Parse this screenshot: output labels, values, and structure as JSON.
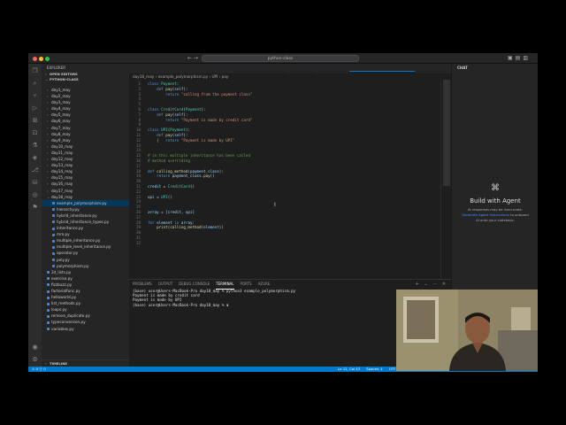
{
  "window": {
    "search": "python-class"
  },
  "activity_icons": [
    "files-icon",
    "search-icon",
    "source-control-icon",
    "run-debug-icon",
    "extensions-icon",
    "remote-icon",
    "testing-icon",
    "docker-icon",
    "git-graph-icon",
    "database-icon",
    "browser-icon",
    "flask-icon"
  ],
  "sidebar": {
    "title": "EXPLORER",
    "open_editors": "OPEN EDITORS",
    "root": "PYTHON-CLASS",
    "outline": "TIMELINE",
    "items": [
      {
        "label": "day1_may",
        "kind": "folder"
      },
      {
        "label": "day2_may",
        "kind": "folder"
      },
      {
        "label": "day3_may",
        "kind": "folder"
      },
      {
        "label": "day4_may",
        "kind": "folder"
      },
      {
        "label": "day5_may",
        "kind": "folder"
      },
      {
        "label": "day6_may",
        "kind": "folder"
      },
      {
        "label": "day7_may",
        "kind": "folder"
      },
      {
        "label": "day8_may",
        "kind": "folder"
      },
      {
        "label": "day9_may",
        "kind": "folder"
      },
      {
        "label": "day10_may",
        "kind": "folder"
      },
      {
        "label": "day11_may",
        "kind": "folder"
      },
      {
        "label": "day12_may",
        "kind": "folder"
      },
      {
        "label": "day13_may",
        "kind": "folder"
      },
      {
        "label": "day14_may",
        "kind": "folder"
      },
      {
        "label": "day15_may",
        "kind": "folder"
      },
      {
        "label": "day16_may",
        "kind": "folder"
      },
      {
        "label": "day17_may",
        "kind": "folder"
      },
      {
        "label": "day18_may",
        "kind": "folder"
      },
      {
        "label": "example_polymorphism.py",
        "kind": "file",
        "selected": true
      },
      {
        "label": "hierarchy.py",
        "kind": "file"
      },
      {
        "label": "hybrid_inheritance.py",
        "kind": "file"
      },
      {
        "label": "hybrid_inheritance_types.py",
        "kind": "file"
      },
      {
        "label": "inheritance.py",
        "kind": "file"
      },
      {
        "label": "mro.py",
        "kind": "file"
      },
      {
        "label": "multiple_inheritance.py",
        "kind": "file"
      },
      {
        "label": "multiple_level_inheritance.py",
        "kind": "file"
      },
      {
        "label": "operator.py",
        "kind": "file"
      },
      {
        "label": "poly.py",
        "kind": "file"
      },
      {
        "label": "polymorphism.py",
        "kind": "file"
      },
      {
        "label": "2d_lists.py",
        "kind": "rootfile"
      },
      {
        "label": "exercise.py",
        "kind": "rootfile"
      },
      {
        "label": "fizzbuzz.py",
        "kind": "rootfile"
      },
      {
        "label": "factorialfunc.py",
        "kind": "rootfile"
      },
      {
        "label": "helloworld.py",
        "kind": "rootfile"
      },
      {
        "label": "list_methods.py",
        "kind": "rootfile"
      },
      {
        "label": "loops.py",
        "kind": "rootfile"
      },
      {
        "label": "remove_duplicate.py",
        "kind": "rootfile"
      },
      {
        "label": "typeconversion.py",
        "kind": "rootfile"
      },
      {
        "label": "variables.py",
        "kind": "rootfile"
      }
    ]
  },
  "tabs": [
    {
      "label": "hybrid_inheritance.py",
      "active": false
    },
    {
      "label": "mro.py",
      "active": false
    },
    {
      "label": "polymorphism.py day18_may",
      "active": false
    },
    {
      "label": "poly.py",
      "active": false
    },
    {
      "label": "operator.py",
      "active": false
    },
    {
      "label": "example_polymorphism.py",
      "active": true
    }
  ],
  "breadcrumb": "day18_may  ›  example_polymorphism.py  ›  UPI  ›  pay",
  "code": [
    {
      "n": "1",
      "html": "<span class='kw'>class</span> <span class='cls'>Payment</span>:"
    },
    {
      "n": "2",
      "html": "    <span class='kw'>def</span> <span class='fn'>pay</span>(<span class='var'>self</span>):"
    },
    {
      "n": "3",
      "html": "        <span class='kw'>return</span> <span class='str'>\"calling from the payment class\"</span>"
    },
    {
      "n": "4",
      "html": ""
    },
    {
      "n": "5",
      "html": ""
    },
    {
      "n": "6",
      "html": "<span class='kw'>class</span> <span class='cls'>CreditCard</span>(<span class='cls'>Payment</span>):"
    },
    {
      "n": "7",
      "html": "    <span class='kw'>def</span> <span class='fn'>pay</span>(<span class='var'>self</span>):"
    },
    {
      "n": "8",
      "html": "        <span class='kw'>return</span> <span class='str'>\"Payment is made by credit card\"</span>"
    },
    {
      "n": "9",
      "html": ""
    },
    {
      "n": "10",
      "html": "<span class='kw'>class</span> <span class='cls'>UPI</span>(<span class='cls'>Payment</span>):"
    },
    {
      "n": "11",
      "html": "    <span class='kw'>def</span> <span class='fn'>pay</span>(<span class='var'>self</span>):"
    },
    {
      "n": "12",
      "html": "    |   <span class='kw'>return</span> <span class='str'>\"Payment is made by UPI\"</span>"
    },
    {
      "n": "13",
      "html": ""
    },
    {
      "n": "14",
      "html": ""
    },
    {
      "n": "15",
      "html": "<span class='cmt'># in this multiple inheritance has been called</span>"
    },
    {
      "n": "16",
      "html": "<span class='cmt'># method overriding</span>"
    },
    {
      "n": "17",
      "html": ""
    },
    {
      "n": "18",
      "html": "<span class='kw'>def</span> <span class='fn'>calling_method</span>(<span class='var'>payment_class</span>):"
    },
    {
      "n": "19",
      "html": "    <span class='kw'>return</span> <span class='var'>payment_class</span>.<span class='fn'>pay</span>()"
    },
    {
      "n": "20",
      "html": ""
    },
    {
      "n": "21",
      "html": "<span class='var'>credit</span> = <span class='cls'>CreditCard</span>()"
    },
    {
      "n": "22",
      "html": ""
    },
    {
      "n": "23",
      "html": "<span class='var'>upi</span> = <span class='cls'>UPI</span>()"
    },
    {
      "n": "24",
      "html": ""
    },
    {
      "n": "25",
      "html": ""
    },
    {
      "n": "26",
      "html": "<span class='var'>array</span> = [<span class='var'>credit</span>, <span class='var'>upi</span>]"
    },
    {
      "n": "27",
      "html": ""
    },
    {
      "n": "28",
      "html": "<span class='kw'>for</span> <span class='var'>element</span> <span class='kw'>in</span> <span class='var'>array</span>:"
    },
    {
      "n": "29",
      "html": "    <span class='fn'>print</span>(<span class='fn'>calling_method</span>(<span class='var'>element</span>))"
    },
    {
      "n": "30",
      "html": ""
    },
    {
      "n": "31",
      "html": ""
    },
    {
      "n": "32",
      "html": ""
    }
  ],
  "panel": {
    "tabs": [
      {
        "label": "PROBLEMS",
        "active": false
      },
      {
        "label": "OUTPUT",
        "active": false
      },
      {
        "label": "DEBUG CONSOLE",
        "active": false
      },
      {
        "label": "TERMINAL",
        "active": true
      },
      {
        "label": "PORTS",
        "active": false
      },
      {
        "label": "AZURE",
        "active": false
      }
    ],
    "terminal": [
      "(base) user@Users-MacBook-Pro day18_may % python3 example_polymorphism.py",
      "Payment is made by credit card",
      "Payment is made by UPI",
      "(base) user@Users-MacBook-Pro day18_may % ▮"
    ]
  },
  "chat": {
    "title": "CHAT",
    "heading": "Build with Agent",
    "line1": "AI responses may be inaccurate.",
    "link": "Generate Agent Instructions",
    "line2": "to onboard",
    "line3": "AI onto your codebase."
  },
  "status": {
    "left": "⚠ 0  ⓧ 0",
    "position": "Ln 12, Col 43",
    "spaces": "Spaces: 4",
    "encoding": "UTF-8"
  },
  "colors": {
    "accent": "#007acc",
    "selection": "#04395e"
  }
}
